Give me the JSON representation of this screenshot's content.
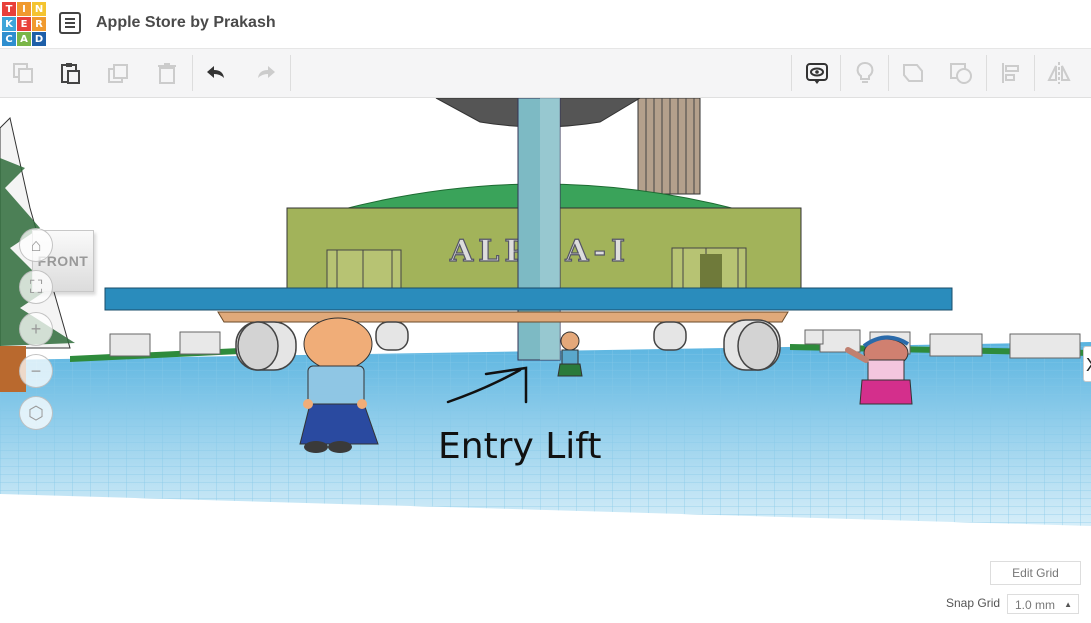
{
  "app": {
    "logo_letters": [
      "T",
      "I",
      "N",
      "K",
      "E",
      "R",
      "C",
      "A",
      "D"
    ],
    "logo_colors": [
      "#e8403a",
      "#f09a2e",
      "#f4c430",
      "#3da5d9",
      "#e8403a",
      "#f09a2e",
      "#2e8ecf",
      "#7ab648",
      "#1e5fa8"
    ],
    "design_title": "Apple Store by Prakash"
  },
  "toolbar": {
    "copy": "copy-icon",
    "paste": "paste-icon",
    "duplicate": "duplicate-icon",
    "delete": "trash-icon",
    "undo": "undo-icon",
    "redo": "redo-icon",
    "notes": "notes-eye-icon",
    "light": "lightbulb-icon",
    "group": "group-icon",
    "ungroup": "ungroup-icon",
    "align": "align-icon",
    "mirror": "mirror-icon"
  },
  "viewport": {
    "view_cube_label": "FRONT",
    "building_sign": "ALPHA-I",
    "annotation_text": "Entry Lift",
    "close_glyph": "X",
    "zoom_in": "+",
    "zoom_out": "−"
  },
  "grid_controls": {
    "edit_grid_label": "Edit Grid",
    "snap_grid_label": "Snap Grid",
    "snap_grid_value": "1.0 mm"
  },
  "colors": {
    "accent_blue": "#2b8fc9",
    "workplane": "#cfeaf7",
    "grid_lines": "#7fc4e6"
  }
}
